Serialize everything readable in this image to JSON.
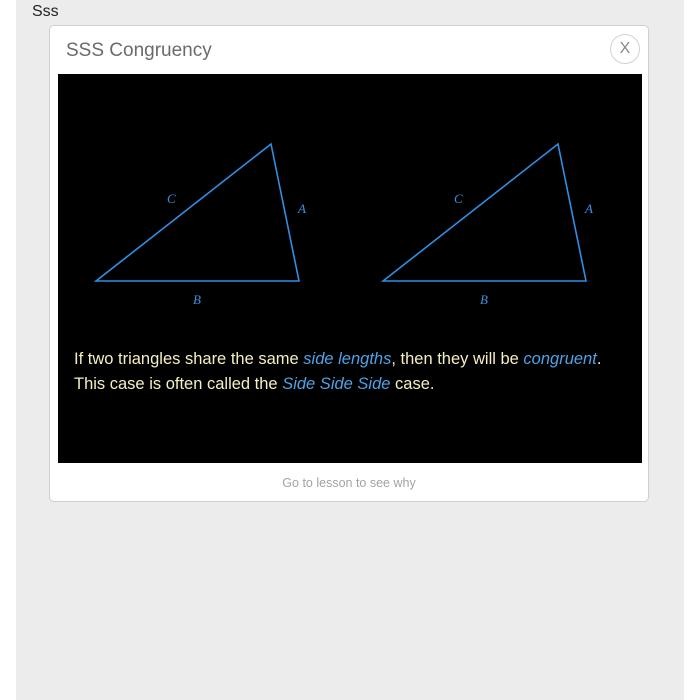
{
  "page": {
    "label": "Sss"
  },
  "modal": {
    "title": "SSS Congruency",
    "close_label": "X",
    "link_text": "Go to lesson to see why"
  },
  "diagram": {
    "triangle_1": {
      "side_a": "A",
      "side_b": "B",
      "side_c": "C"
    },
    "triangle_2": {
      "side_a": "A",
      "side_b": "B",
      "side_c": "C"
    },
    "stroke_color": "#2f8fe4",
    "background_color": "#000000"
  },
  "explanation": {
    "line1_part1": "If two triangles share the same ",
    "line1_highlight1": "side lengths",
    "line1_part2": ", then they will be ",
    "line1_highlight2": "congruent",
    "line1_part3": ".",
    "line2_part1": "This case is often called the ",
    "line2_highlight": "Side Side Side",
    "line2_part2": " case."
  },
  "colors": {
    "text": "#f5efc0",
    "highlight": "#4da3e8"
  }
}
